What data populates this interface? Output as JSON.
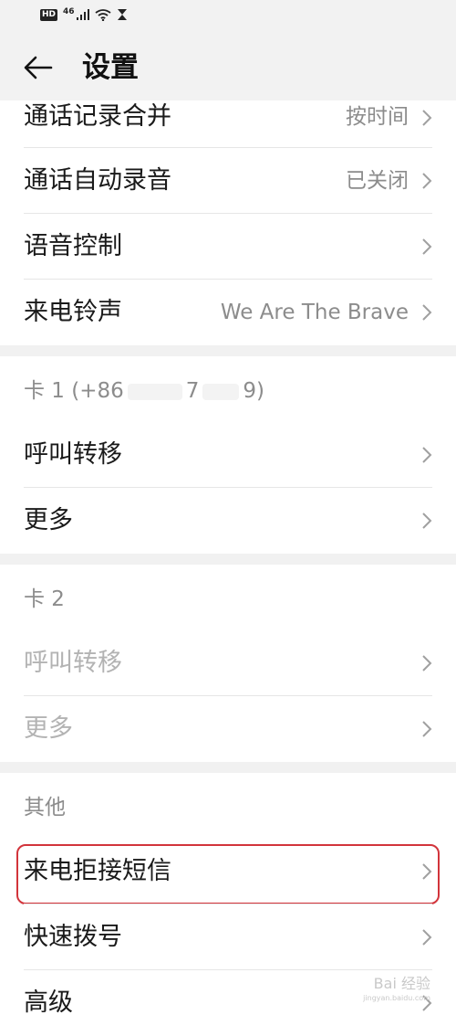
{
  "status": {
    "hd": "HD",
    "network": "46"
  },
  "header": {
    "title": "设置"
  },
  "general": [
    {
      "label": "通话记录合并",
      "value": "按时间"
    },
    {
      "label": "通话自动录音",
      "value": "已关闭"
    },
    {
      "label": "语音控制",
      "value": ""
    },
    {
      "label": "来电铃声",
      "value": "We Are The Brave"
    }
  ],
  "card1": {
    "header": {
      "prefix": "卡 1 (+86",
      "mid": "7",
      "suffix": "9)"
    },
    "items": [
      {
        "label": "呼叫转移"
      },
      {
        "label": "更多"
      }
    ]
  },
  "card2": {
    "header": "卡 2",
    "items": [
      {
        "label": "呼叫转移"
      },
      {
        "label": "更多"
      }
    ]
  },
  "other": {
    "header": "其他",
    "items": [
      {
        "label": "来电拒接短信"
      },
      {
        "label": "快速拨号"
      },
      {
        "label": "高级"
      }
    ]
  },
  "watermark": {
    "line1": "Bai 经验",
    "line2": "jingyan.baidu.com"
  },
  "colors": {
    "highlight": "#d2343b",
    "secondary_text": "#8c8c8c",
    "disabled_text": "#b3b3b3"
  }
}
